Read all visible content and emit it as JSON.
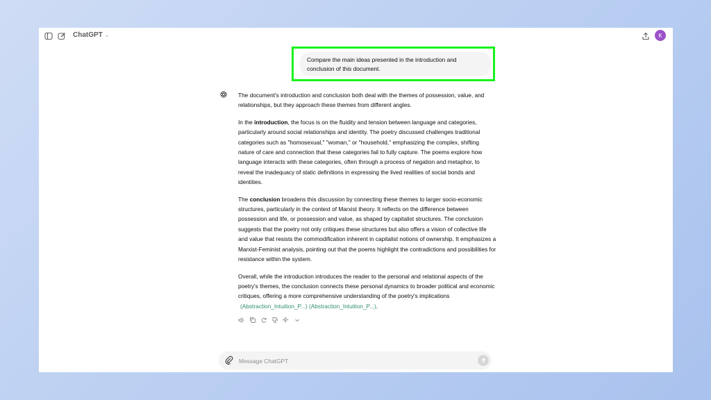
{
  "header": {
    "model_name": "ChatGPT",
    "avatar_initial": "K"
  },
  "user_message": "Compare the main ideas presented in the introduction and conclusion of this document.",
  "answer": {
    "p1": "The document's introduction and conclusion both deal with the themes of possession, value, and relationships, but they approach these themes from different angles.",
    "p2_prefix": "In the ",
    "p2_bold": "introduction",
    "p2_rest": ", the focus is on the fluidity and tension between language and categories, particularly around social relationships and identity. The poetry discussed challenges traditional categories such as \"homosexual,\" \"woman,\" or \"household,\" emphasizing the complex, shifting nature of care and connection that these categories fail to fully capture. The poems explore how language interacts with these categories, often through a process of negation and metaphor, to reveal the inadequacy of static definitions in expressing the lived realities of social bonds and identities.",
    "p3_prefix": "The ",
    "p3_bold": "conclusion",
    "p3_rest": " broadens this discussion by connecting these themes to larger socio-economic structures, particularly in the context of Marxist theory. It reflects on the difference between possession and life, or possession and value, as shaped by capitalist structures. The conclusion suggests that the poetry not only critiques these structures but also offers a vision of collective life and value that resists the commodification inherent in capitalist notions of ownership. It emphasizes a Marxist-Feminist analysis, pointing out that the poems highlight the contradictions and possibilities for resistance within the system.",
    "p4": "Overall, while the introduction introduces the reader to the personal and relational aspects of the poetry's themes, the conclusion connects these personal dynamics to broader political and economic critiques, offering a more comprehensive understanding of the poetry's implications",
    "citation": "(Abstraction_Intuition_P...) (Abstraction_Intuition_P...)",
    "end": "."
  },
  "composer": {
    "placeholder": "Message ChatGPT"
  },
  "icons": {
    "sidebar": "sidebar-icon",
    "new_chat": "new-chat-icon",
    "share": "share-icon",
    "attach": "paperclip-icon",
    "send": "arrow-up-icon"
  },
  "colors": {
    "highlight": "#19f21c",
    "avatar": "#9b51c9",
    "citation": "#2f8f6a"
  }
}
